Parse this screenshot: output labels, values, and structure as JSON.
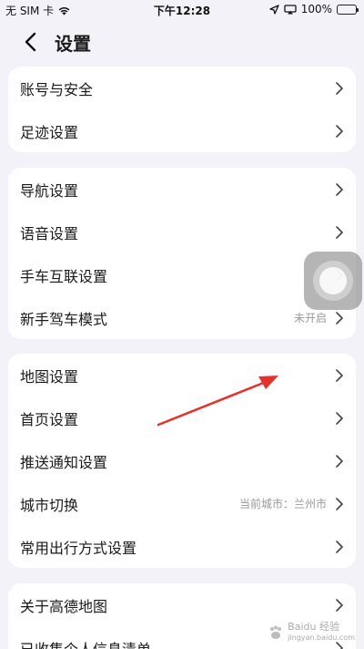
{
  "status_bar": {
    "carrier": "无 SIM 卡",
    "time": "下午12:28",
    "battery": "100%",
    "battery_level": 1.0,
    "battery_color": "#34c759",
    "icons": [
      "wifi-icon",
      "location-icon",
      "screen-mirror-icon",
      "battery-icon"
    ]
  },
  "header": {
    "title": "设置",
    "back_icon": "chevron-left-icon"
  },
  "groups": [
    {
      "items": [
        {
          "label": "账号与安全"
        },
        {
          "label": "足迹设置"
        }
      ]
    },
    {
      "items": [
        {
          "label": "导航设置"
        },
        {
          "label": "语音设置"
        },
        {
          "label": "手车互联设置"
        },
        {
          "label": "新手驾车模式",
          "value": "未开启"
        }
      ]
    },
    {
      "items": [
        {
          "label": "地图设置"
        },
        {
          "label": "首页设置"
        },
        {
          "label": "推送通知设置"
        },
        {
          "label": "城市切换",
          "value": "当前城市：兰州市"
        },
        {
          "label": "常用出行方式设置"
        }
      ]
    },
    {
      "items": [
        {
          "label": "关于高德地图"
        },
        {
          "label": "已收集个人信息清单"
        }
      ]
    }
  ],
  "annotation": {
    "arrow_color": "#e8302a"
  },
  "watermark": {
    "text": "Baidu 经验",
    "sub": "jingyan.baidu.com"
  }
}
